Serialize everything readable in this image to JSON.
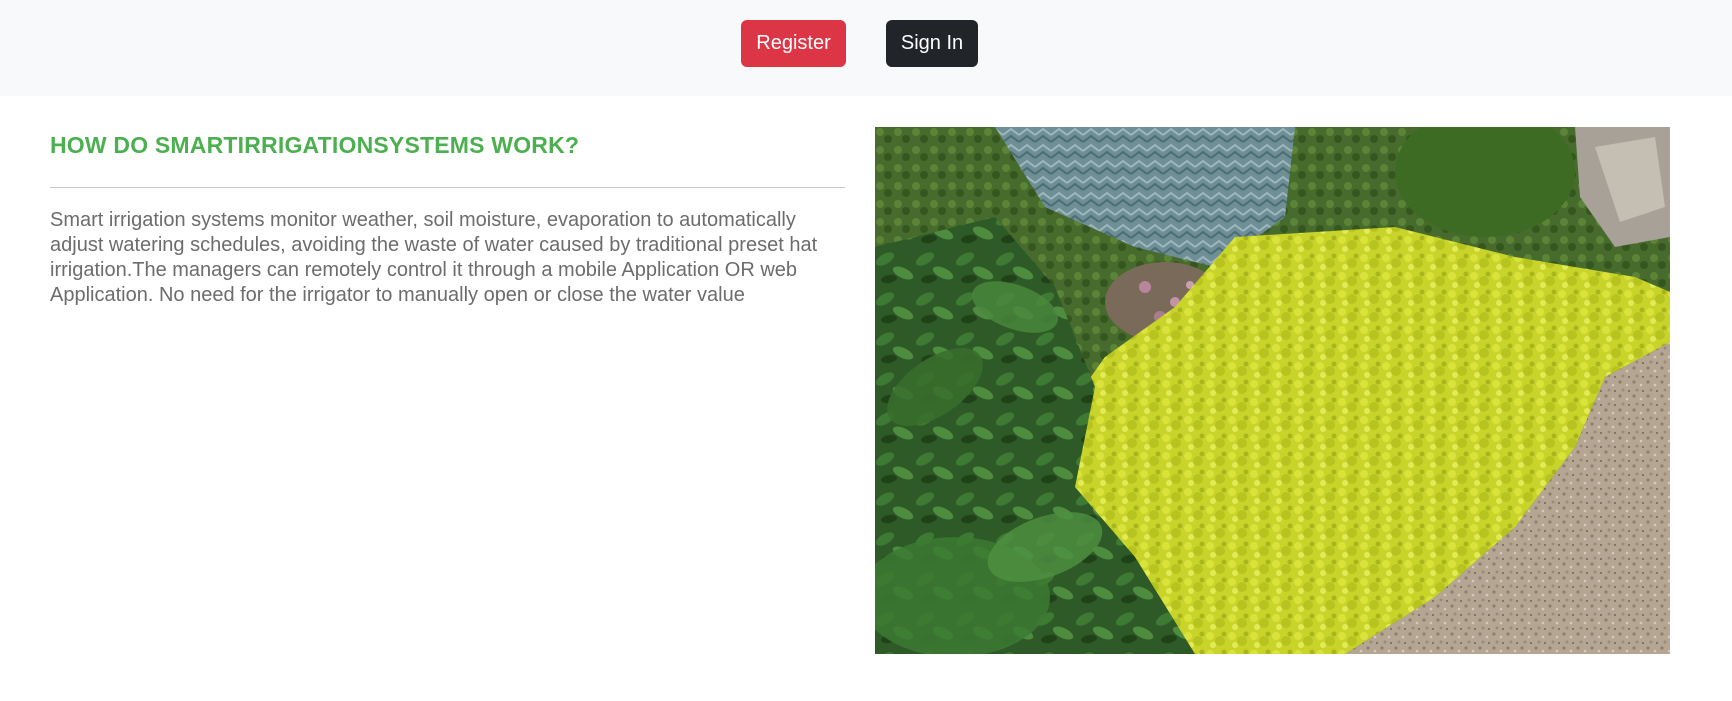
{
  "header": {
    "register_label": "Register",
    "signin_label": "Sign In",
    "colors": {
      "background": "#f8f9fa",
      "register": "#dc3545",
      "signin": "#212529"
    }
  },
  "main": {
    "heading": "HOW DO SMARTIRRIGATIONSYSTEMS WORK?",
    "heading_color": "#4caf50",
    "paragraph": "Smart irrigation systems monitor weather, soil moisture, evaporation to automatically adjust watering schedules, avoiding the waste of water caused by traditional preset hat irrigation.The managers can remotely control it through a mobile Application OR web Application. No need for the irrigator to manually open or close the water value",
    "image": {
      "subject": "garden-bed-with-yellow-groundcover-and-gravel-path"
    }
  }
}
